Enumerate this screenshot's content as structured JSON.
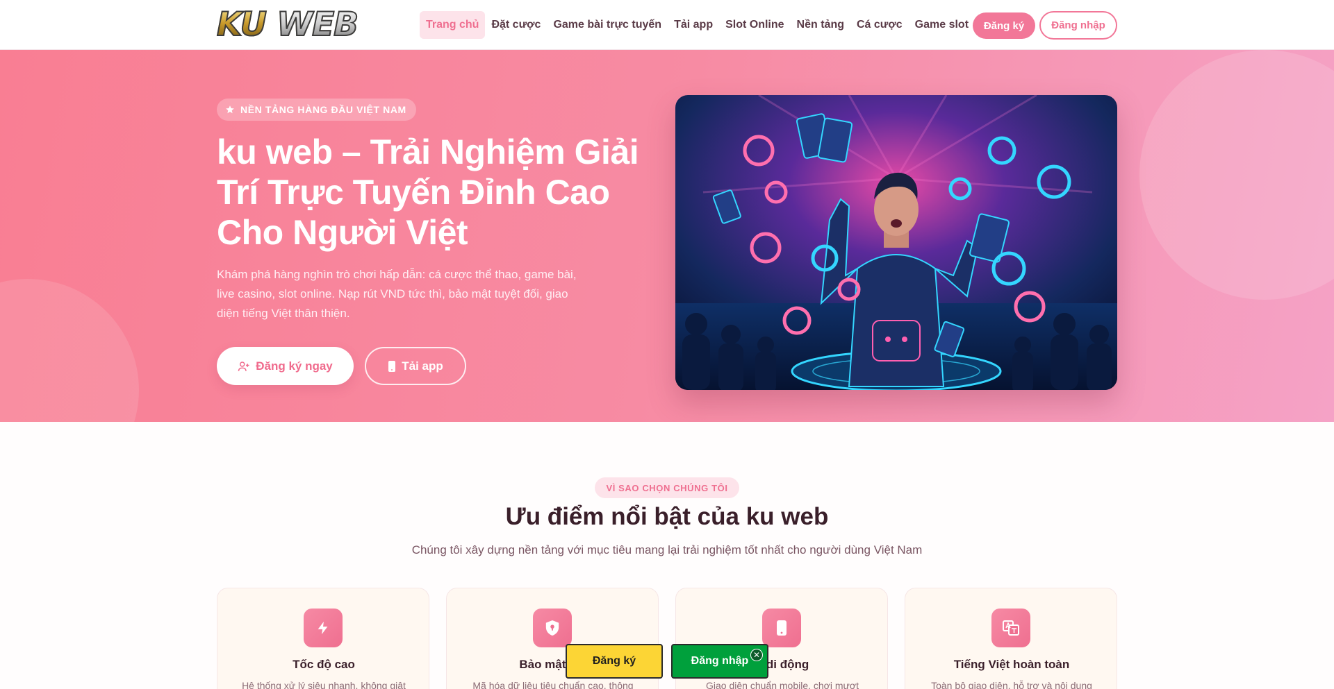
{
  "header": {
    "logo_text_ku": "KU",
    "logo_text_web": "WEB",
    "nav": [
      {
        "label": "Trang chủ",
        "active": true
      },
      {
        "label": "Đặt cược"
      },
      {
        "label": "Game bài trực tuyến"
      },
      {
        "label": "Tải app"
      },
      {
        "label": "Slot Online"
      },
      {
        "label": "Nền tảng"
      },
      {
        "label": "Cá cược"
      },
      {
        "label": "Game slot"
      }
    ],
    "register_label": "Đăng ký",
    "login_label": "Đăng nhập"
  },
  "hero": {
    "badge": "NỀN TẢNG HÀNG ĐẦU VIỆT NAM",
    "title": "ku web – Trải Nghiệm Giải Trí Trực Tuyến Đỉnh Cao Cho Người Việt",
    "description": "Khám phá hàng nghìn trò chơi hấp dẫn: cá cược thể thao, game bài, live casino, slot online. Nạp rút VND tức thì, bảo mật tuyệt đối, giao diện tiếng Việt thân thiện.",
    "register_btn": "Đăng ký ngay",
    "app_btn": "Tải app"
  },
  "features": {
    "tag": "VÌ SAO CHỌN CHÚNG TÔI",
    "title": "Ưu điểm nổi bật của ku web",
    "subtitle": "Chúng tôi xây dựng nền tảng với mục tiêu mang lại trải nghiệm tốt nhất cho người dùng Việt Nam",
    "cards": [
      {
        "icon": "lightning-icon",
        "title": "Tốc độ cao",
        "desc": "Hệ thống xử lý siêu nhanh, không giật"
      },
      {
        "icon": "shield-icon",
        "title": "Bảo mật tuy",
        "desc": "Mã hóa dữ liệu tiêu chuẩn cao, thông"
      },
      {
        "icon": "mobile-icon",
        "title": "u di động",
        "desc": "Giao diện chuẩn mobile, chơi mượt"
      },
      {
        "icon": "translate-icon",
        "title": "Tiếng Việt hoàn toàn",
        "desc": "Toàn bộ giao diện, hỗ trợ và nội dung"
      }
    ]
  },
  "floating": {
    "register": "Đăng ký",
    "login": "Đăng nhập",
    "close": "✕"
  },
  "colors": {
    "accent": "#f27798",
    "hero_start": "#f97e93",
    "hero_end": "#f5a2c6",
    "float_register": "#fcd535",
    "float_login": "#00a03c"
  }
}
